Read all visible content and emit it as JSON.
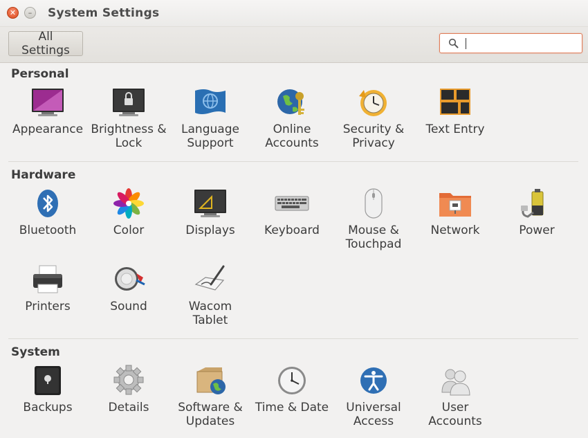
{
  "window": {
    "title": "System Settings"
  },
  "toolbar": {
    "all_settings_label": "All Settings",
    "search_placeholder": "",
    "search_value": ""
  },
  "sections": [
    {
      "title": "Personal",
      "items": [
        {
          "label": "Appearance",
          "icon": "appearance-icon"
        },
        {
          "label": "Brightness & Lock",
          "icon": "brightness-lock-icon"
        },
        {
          "label": "Language Support",
          "icon": "language-icon"
        },
        {
          "label": "Online Accounts",
          "icon": "online-accounts-icon"
        },
        {
          "label": "Security & Privacy",
          "icon": "security-privacy-icon"
        },
        {
          "label": "Text Entry",
          "icon": "text-entry-icon"
        }
      ]
    },
    {
      "title": "Hardware",
      "items": [
        {
          "label": "Bluetooth",
          "icon": "bluetooth-icon"
        },
        {
          "label": "Color",
          "icon": "color-icon"
        },
        {
          "label": "Displays",
          "icon": "displays-icon"
        },
        {
          "label": "Keyboard",
          "icon": "keyboard-icon"
        },
        {
          "label": "Mouse & Touchpad",
          "icon": "mouse-icon"
        },
        {
          "label": "Network",
          "icon": "network-icon"
        },
        {
          "label": "Power",
          "icon": "power-icon"
        },
        {
          "label": "Printers",
          "icon": "printer-icon"
        },
        {
          "label": "Sound",
          "icon": "sound-icon"
        },
        {
          "label": "Wacom Tablet",
          "icon": "wacom-icon"
        }
      ]
    },
    {
      "title": "System",
      "items": [
        {
          "label": "Backups",
          "icon": "backups-icon"
        },
        {
          "label": "Details",
          "icon": "gear-icon"
        },
        {
          "label": "Software & Updates",
          "icon": "software-updates-icon"
        },
        {
          "label": "Time & Date",
          "icon": "clock-icon"
        },
        {
          "label": "Universal Access",
          "icon": "universal-access-icon"
        },
        {
          "label": "User Accounts",
          "icon": "users-icon"
        }
      ]
    }
  ]
}
